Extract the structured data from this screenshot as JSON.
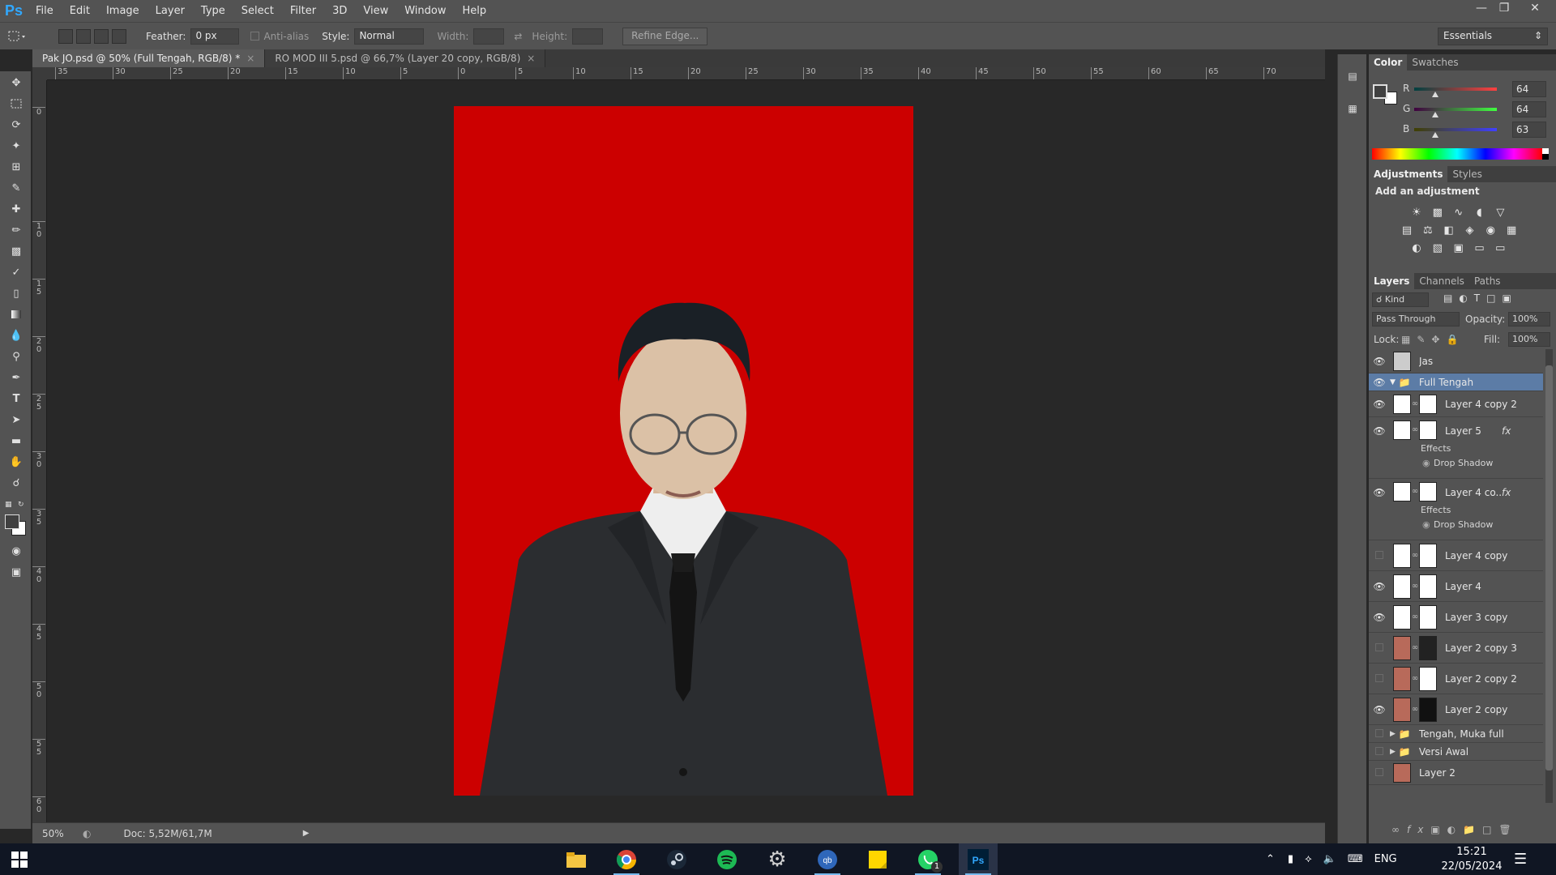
{
  "app": {
    "logo": "Ps"
  },
  "menu": [
    "File",
    "Edit",
    "Image",
    "Layer",
    "Type",
    "Select",
    "Filter",
    "3D",
    "View",
    "Window",
    "Help"
  ],
  "options": {
    "feather_label": "Feather:",
    "feather_value": "0 px",
    "antialias_label": "Anti-alias",
    "style_label": "Style:",
    "style_value": "Normal",
    "width_label": "Width:",
    "height_label": "Height:",
    "refine_edge": "Refine Edge...",
    "workspace": "Essentials"
  },
  "tabs": [
    {
      "label": "Pak JO.psd @ 50% (Full Tengah, RGB/8) *",
      "active": true
    },
    {
      "label": "RO MOD III 5.psd @ 66,7% (Layer 20 copy, RGB/8)",
      "active": false
    }
  ],
  "ruler_h": [
    "35",
    "30",
    "25",
    "20",
    "15",
    "10",
    "5",
    "0",
    "5",
    "10",
    "15",
    "20",
    "25",
    "30",
    "35",
    "40",
    "45",
    "50",
    "55",
    "60",
    "65",
    "70"
  ],
  "ruler_v": [
    "0",
    "1\n0",
    "1\n5",
    "2\n0",
    "2\n5",
    "3\n0",
    "3\n5",
    "4\n0",
    "4\n5",
    "5\n0",
    "5\n5",
    "6\n0"
  ],
  "status": {
    "zoom": "50%",
    "doc": "Doc: 5,52M/61,7M"
  },
  "color_panel": {
    "tabs": [
      "Color",
      "Swatches"
    ],
    "r_label": "R",
    "g_label": "G",
    "b_label": "B",
    "r": "64",
    "g": "64",
    "b": "63",
    "r_level": 0.25,
    "g_level": 0.25,
    "b_level": 0.25
  },
  "adjust_panel": {
    "tabs": [
      "Adjustments",
      "Styles"
    ],
    "heading": "Add an adjustment"
  },
  "layers_panel": {
    "tabs": [
      "Layers",
      "Channels",
      "Paths"
    ],
    "kind": "Kind",
    "blend_mode": "Pass Through",
    "opacity_label": "Opacity:",
    "opacity": "100%",
    "lock_label": "Lock:",
    "fill_label": "Fill:",
    "fill": "100%",
    "effects_label": "Effects",
    "drop_shadow_label": "Drop Shadow",
    "layers": [
      {
        "name": "Jas",
        "visible": true
      },
      {
        "name": "Full Tengah",
        "visible": true,
        "group": true,
        "selected": true
      },
      {
        "name": "Layer 4 copy 2",
        "visible": true
      },
      {
        "name": "Layer 5",
        "visible": true,
        "fx": true
      },
      {
        "name": "Layer 4 co...",
        "visible": true,
        "fx": true
      },
      {
        "name": "Layer 4 copy",
        "visible": false
      },
      {
        "name": "Layer 4",
        "visible": true
      },
      {
        "name": "Layer 3 copy",
        "visible": true
      },
      {
        "name": "Layer 2 copy 3",
        "visible": false
      },
      {
        "name": "Layer 2 copy 2",
        "visible": false
      },
      {
        "name": "Layer 2 copy",
        "visible": true
      },
      {
        "name": "Tengah, Muka full",
        "visible": false,
        "group": true
      },
      {
        "name": "Versi Awal",
        "visible": false,
        "group": true
      },
      {
        "name": "Layer 2",
        "visible": false
      }
    ]
  },
  "taskbar": {
    "lang": "ENG",
    "time": "15:21",
    "date": "22/05/2024",
    "whatsapp_badge": "1"
  },
  "colors": {
    "canvas_red": "#cc0000",
    "ps_blue": "#31a8ff"
  }
}
